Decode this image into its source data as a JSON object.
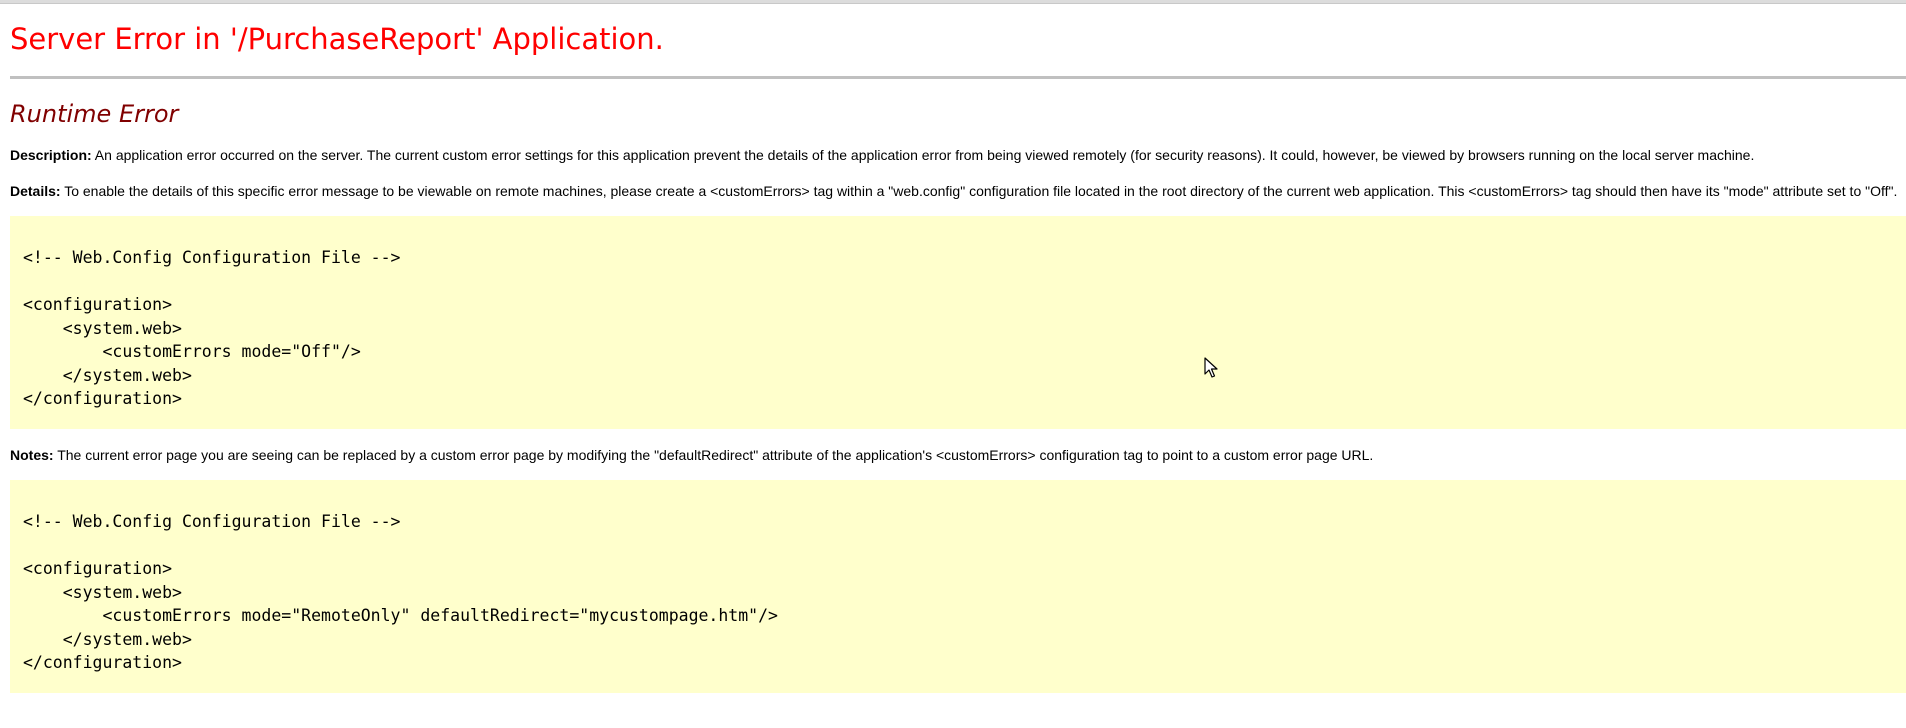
{
  "page": {
    "title": "Server Error in '/PurchaseReport' Application.",
    "subtitle": "Runtime Error"
  },
  "description": {
    "label": "Description:",
    "text": " An application error occurred on the server. The current custom error settings for this application prevent the details of the application error from being viewed remotely (for security reasons). It could, however, be viewed by browsers running on the local server machine."
  },
  "details": {
    "label": "Details:",
    "text": " To enable the details of this specific error message to be viewable on remote machines, please create a <customErrors> tag within a \"web.config\" configuration file located in the root directory of the current web application. This <customErrors> tag should then have its \"mode\" attribute set to \"Off\"."
  },
  "code_sample_1": {
    "lines": [
      "<!-- Web.Config Configuration File -->",
      "",
      "<configuration>",
      "    <system.web>",
      "        <customErrors mode=\"Off\"/>",
      "    </system.web>",
      "</configuration>"
    ]
  },
  "notes": {
    "label": "Notes:",
    "text": " The current error page you are seeing can be replaced by a custom error page by modifying the \"defaultRedirect\" attribute of the application's <customErrors> configuration tag to point to a custom error page URL."
  },
  "code_sample_2": {
    "lines": [
      "<!-- Web.Config Configuration File -->",
      "",
      "<configuration>",
      "    <system.web>",
      "        <customErrors mode=\"RemoteOnly\" defaultRedirect=\"mycustompage.htm\"/>",
      "    </system.web>",
      "</configuration>"
    ]
  },
  "colors": {
    "title": "#ff0000",
    "subtitle": "#800000",
    "code_background": "#ffffcc"
  },
  "icons": {
    "cursor": "mouse-pointer-icon"
  }
}
